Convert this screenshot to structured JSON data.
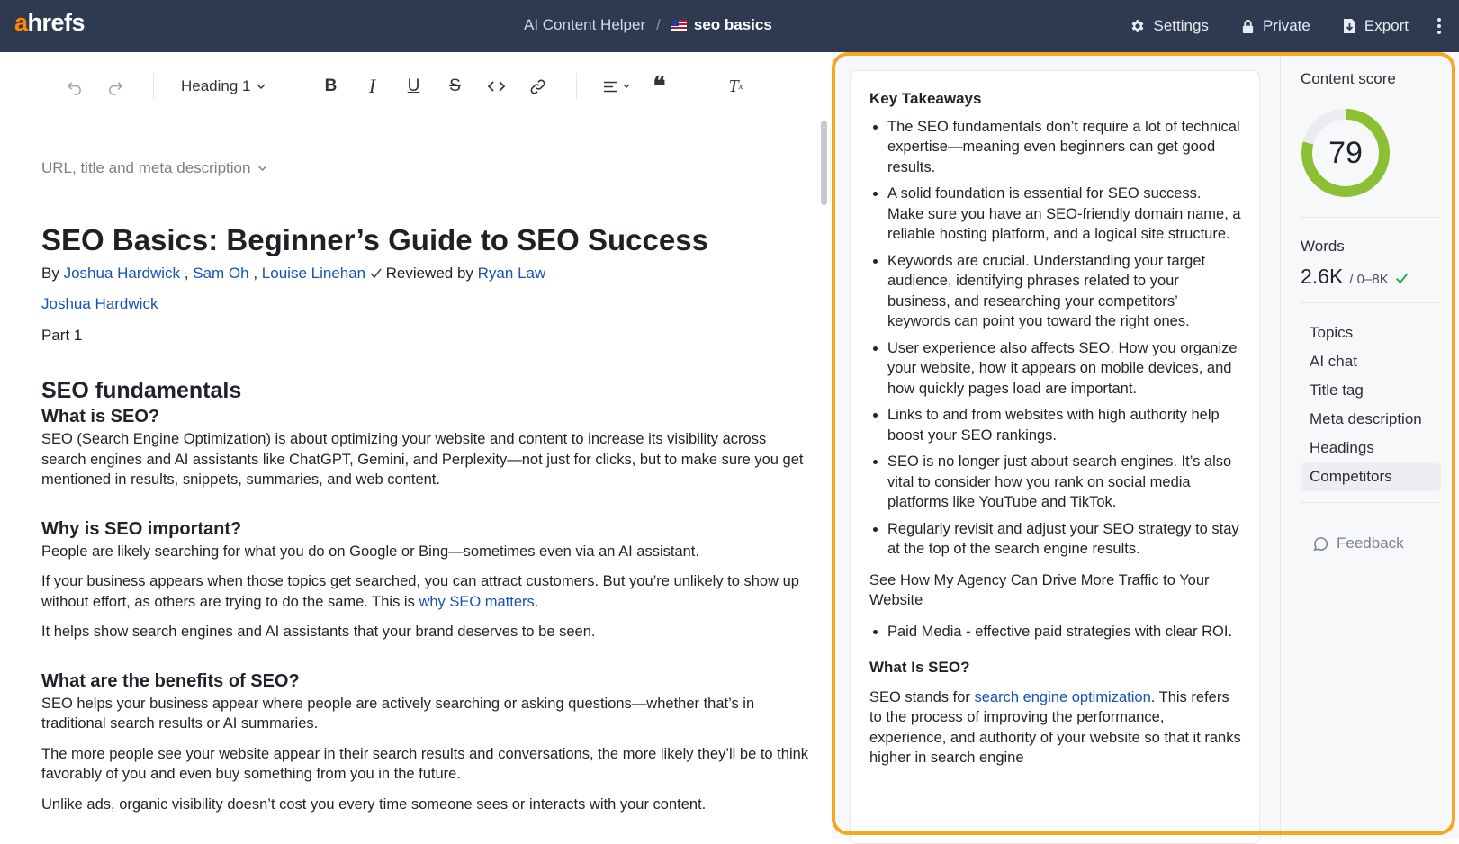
{
  "topbar": {
    "logo_a": "a",
    "logo_rest": "hrefs",
    "app_name": "AI Content Helper",
    "separator": "/",
    "doc_name": "seo basics",
    "settings_label": "Settings",
    "private_label": "Private",
    "export_label": "Export"
  },
  "toolbar": {
    "heading_select": "Heading 1"
  },
  "editor": {
    "meta_toggle": "URL, title and meta description",
    "title": "SEO Basics: Beginner’s Guide to SEO Success",
    "byline": {
      "by": "By",
      "author1": "Joshua Hardwick",
      "author2": "Sam Oh",
      "author3": "Louise Linehan",
      "reviewed_by": "Reviewed by",
      "reviewer": "Ryan Law",
      "comma": ","
    },
    "author_line": "Joshua Hardwick",
    "part": "Part 1",
    "section_title": "SEO fundamentals",
    "blocks": {
      "what_is_h": "What is SEO?",
      "what_is_p": "SEO (Search Engine Optimization) is about optimizing your website and content to increase its visibility across search engines and AI assistants like ChatGPT, Gemini, and Perplexity—not just for clicks, but to make sure you get mentioned in results, snippets, summaries, and web content.",
      "why_h": "Why is SEO important?",
      "why_p1": "People are likely searching for what you do on Google or Bing—sometimes even via an AI assistant.",
      "why_p2_pre": "If your business appears when those topics get searched, you can attract customers. But you’re unlikely to show up without effort, as others are trying to do the same. This is ",
      "why_p2_link": "why SEO matters",
      "why_p2_post": ".",
      "why_p3": "It helps show search engines and AI assistants that your brand deserves to be seen.",
      "benefits_h": "What are the benefits of SEO?",
      "benefits_p1": "SEO helps your business appear where people are actively searching or asking questions—whether that’s in traditional search results or AI summaries.",
      "benefits_p2": "The more people see your website appear in their search results and conversations, the more likely they’ll be to think favorably of you and even buy something from you in the future.",
      "benefits_p3": "Unlike ads, organic visibility doesn’t cost you every time someone sees or interacts with your content."
    }
  },
  "takeaways": {
    "heading": "Key Takeaways",
    "items": [
      "The SEO fundamentals don’t require a lot of technical expertise—meaning even beginners can get good results.",
      "A solid foundation is essential for SEO success. Make sure you have an SEO-friendly domain name, a reliable hosting platform, and a logical site structure.",
      "Keywords are crucial. Understanding your target audience, identifying phrases related to your business, and researching your competitors’ keywords can point you toward the right ones.",
      "User experience also affects SEO. How you organize your website, how it appears on mobile devices, and how quickly pages load are important.",
      "Links to and from websites with high authority help boost your SEO rankings.",
      "SEO is no longer just about search engines. It’s also vital to consider how you rank on social media platforms like YouTube and TikTok.",
      "Regularly revisit and adjust your SEO strategy to stay at the top of the search engine results."
    ],
    "agency_text": "See How My Agency Can Drive More Traffic to Your Website",
    "agency_items": [
      "Paid Media - effective paid strategies with clear ROI."
    ],
    "what_is_heading": "What Is SEO?",
    "what_is_pre": "SEO stands for ",
    "what_is_link": "search engine optimization",
    "what_is_post": ". This refers to the process of improving the performance, experience, and authority of your website so that it ranks higher in search engine"
  },
  "sidebar": {
    "content_score_label": "Content score",
    "content_score": 79,
    "content_score_display": "79",
    "score_color": "#8cbf34",
    "words_label": "Words",
    "words_value": "2.6K",
    "words_range": "/ 0–8K",
    "nav": [
      "Topics",
      "AI chat",
      "Title tag",
      "Meta description",
      "Headings",
      "Competitors"
    ],
    "active_nav": "Competitors",
    "feedback_label": "Feedback"
  },
  "colors": {
    "topbar_bg": "#2e3a4f",
    "brand_orange": "#ff8800",
    "link_blue": "#1553b6",
    "highlight_border": "#f5a623",
    "check_green": "#3aa655"
  }
}
